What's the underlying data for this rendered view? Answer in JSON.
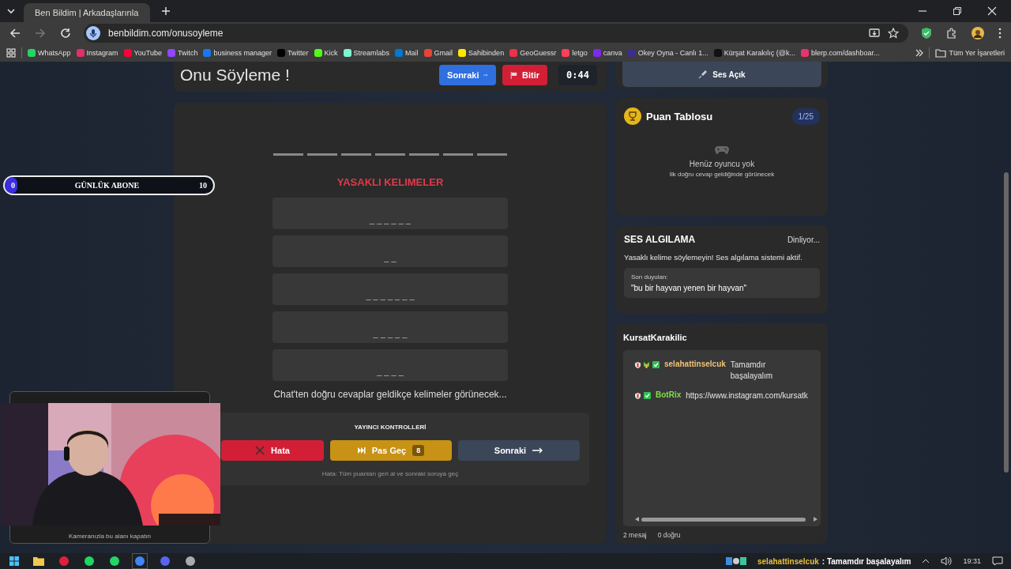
{
  "browser": {
    "tab_title": "Ben Bildim | Arkadaşlarınla",
    "url": "benbildim.com/onusoyleme",
    "bookmarks": [
      {
        "label": "WhatsApp",
        "color": "#25d366"
      },
      {
        "label": "Instagram",
        "color": "#e1306c"
      },
      {
        "label": "YouTube",
        "color": "#ff0033"
      },
      {
        "label": "Twitch",
        "color": "#9146ff"
      },
      {
        "label": "business manager",
        "color": "#1877f2"
      },
      {
        "label": "Twitter",
        "color": "#000000"
      },
      {
        "label": "Kick",
        "color": "#53fc18"
      },
      {
        "label": "Streamlabs",
        "color": "#80f5d2"
      },
      {
        "label": "Mail",
        "color": "#0078d4"
      },
      {
        "label": "Gmail",
        "color": "#ea4335"
      },
      {
        "label": "Sahibinden",
        "color": "#ffe800"
      },
      {
        "label": "GeoGuessr",
        "color": "#e8334a"
      },
      {
        "label": "letgo",
        "color": "#ff3f55"
      },
      {
        "label": "canva",
        "color": "#7d2ae8"
      },
      {
        "label": "Okey Oyna - Canlı 1...",
        "color": "#3b2e8f"
      },
      {
        "label": "Kürşat Karakılıç (@k...",
        "color": "#111111"
      },
      {
        "label": "blerp.com/dashboar...",
        "color": "#e8336d"
      }
    ],
    "all_bookmarks": "Tüm Yer İşaretleri"
  },
  "header": {
    "title": "Onu Söyleme !",
    "next_button": "Sonraki",
    "finish_button": "Bitir",
    "timer": "0:44"
  },
  "game": {
    "answer_slots": [
      {
        "filled": false
      },
      {
        "filled": false
      },
      {
        "filled": false
      },
      {
        "filled": false
      },
      {
        "filled": false
      },
      {
        "filled": false
      },
      {
        "filled": false
      }
    ],
    "banned_title": "YASAKLI KELIMELER",
    "banned_words": [
      "_ _ _ _ _ _",
      "_ _",
      "_ _ _ _ _ _ _",
      "_ _ _ _ _",
      "_ _ _ _"
    ],
    "hint": "Chat'ten doğru cevaplar geldikçe kelimeler görünecek...",
    "controls": {
      "title": "YAYINCI KONTROLLERİ",
      "buttons": [
        {
          "kind": "error",
          "label": "Hata"
        },
        {
          "kind": "pass",
          "label": "Pas Geç",
          "count": "8"
        },
        {
          "kind": "next",
          "label": "Sonraki"
        }
      ],
      "note": "Hata: Tüm puanları geri al ve sonraki soruya geç"
    }
  },
  "sound_button": "Ses Açık",
  "leaderboard": {
    "title": "Puan Tablosu",
    "round": "1/25",
    "empty_title": "Henüz oyuncu yok",
    "empty_hint": "İlk doğru cevap geldiğinde görünecek"
  },
  "voice": {
    "title": "SES ALGILAMA",
    "status": "Dinliyor...",
    "warning": "Yasaklı kelime söylemeyin! Ses algılama sistemi aktif.",
    "last_label": "Son duyulan:",
    "last_heard": "\"bu bir hayvan yenen bir hayvan\""
  },
  "chat": {
    "channel": "KursatKarakilic",
    "messages": [
      {
        "user": "selahattinselcuk",
        "color": "#f0c27a",
        "text": "Tamamdır başalayalım"
      },
      {
        "user": "BotRix",
        "color": "#7ee04a",
        "text": "https://www.instagram.com/kursatk"
      }
    ],
    "message_count": "2 mesaj",
    "correct_count": "0 doğru"
  },
  "sub_goal": {
    "current": "0",
    "label": "GÜNLÜK ABONE",
    "goal": "10",
    "level": 0.06
  },
  "camera": {
    "caption": "Kameranızla bu alanı kapatın"
  },
  "taskbar": {
    "notification_user": "selahattinselcuk",
    "notification_text": ": Tamamdır başalayalım",
    "time": "19:31"
  }
}
